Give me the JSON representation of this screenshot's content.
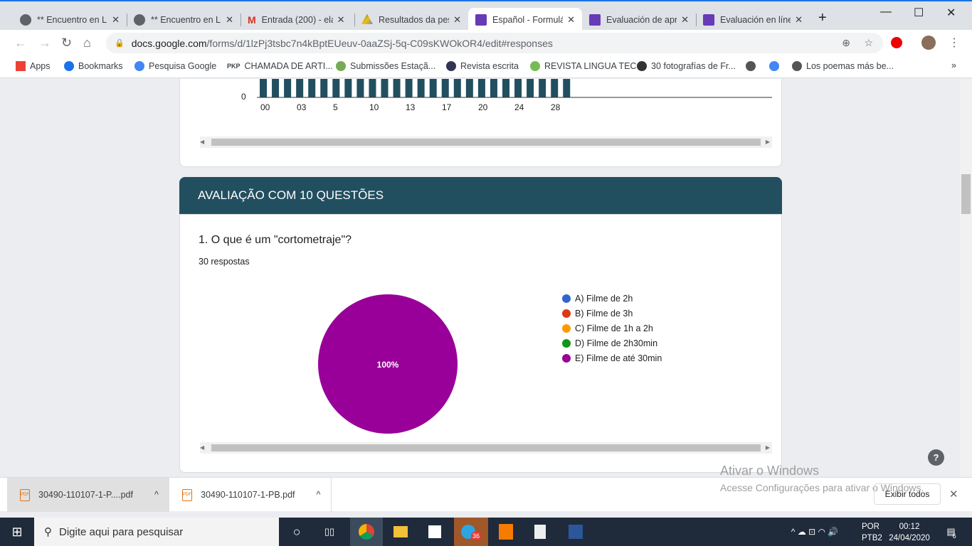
{
  "browser": {
    "tabs": [
      {
        "title": "** Encuentro en Lí",
        "icon": "globe-icon"
      },
      {
        "title": "** Encuentro en Lí",
        "icon": "globe-icon"
      },
      {
        "title": "Entrada (200) - ela",
        "icon": "gmail-icon"
      },
      {
        "title": "Resultados da pes",
        "icon": "drive-icon"
      },
      {
        "title": "Español - Formulá",
        "icon": "forms-icon",
        "active": true
      },
      {
        "title": "Evaluación de apre",
        "icon": "forms-icon"
      },
      {
        "title": "Evaluación en líne",
        "icon": "forms-icon"
      }
    ],
    "url_host": "docs.google.com",
    "url_path": "/forms/d/1lzPj3tsbc7n4kBptEUeuv-0aaZSj-5q-C09sKWOkOR4/edit#responses",
    "bookmarks": [
      "Apps",
      "Bookmarks",
      "Pesquisa Google",
      "CHAMADA DE ARTI...",
      "Submissões Estaçã...",
      "Revista escrita",
      "REVISTA LINGUA TEC",
      "30 fotografías de Fr...",
      "",
      "",
      "Los poemas más be..."
    ],
    "pkp_label": "PKP"
  },
  "section": {
    "title": "AVALIAÇÃO COM 10 QUESTÕES"
  },
  "question": {
    "title": "1. O que é um \"cortometraje\"?",
    "responses": "30 respostas"
  },
  "chart_data": [
    {
      "type": "bar",
      "x_tick_labels": [
        "00",
        "03",
        "5",
        "10",
        "13",
        "17",
        "20",
        "24",
        "28"
      ],
      "y_tick_labels": [
        "0"
      ],
      "color": "#214f60"
    },
    {
      "type": "pie",
      "categories": [
        "A) Filme de 2h",
        "B) Filme de 3h",
        "C) Filme de 1h a 2h",
        "D) Filme de 2h30min",
        "E) Filme de até 30min"
      ],
      "values": [
        0,
        0,
        0,
        0,
        100
      ],
      "colors": [
        "#3366cc",
        "#dc3912",
        "#ff9900",
        "#109618",
        "#990099"
      ],
      "slice_labels": [
        "100%"
      ],
      "legend": "right"
    }
  ],
  "downloads": {
    "items": [
      "30490-110107-1-P....pdf",
      "30490-110107-1-PB.pdf"
    ],
    "show_all": "Exibir todos"
  },
  "watermark": {
    "title": "Ativar o Windows",
    "subtitle": "Acesse Configurações para ativar o Windows."
  },
  "taskbar": {
    "search": "Digite aqui para pesquisar",
    "lang1": "POR",
    "lang2": "PTB2",
    "time": "00:12",
    "date": "24/04/2020",
    "notifications": "6",
    "badge": "36"
  }
}
